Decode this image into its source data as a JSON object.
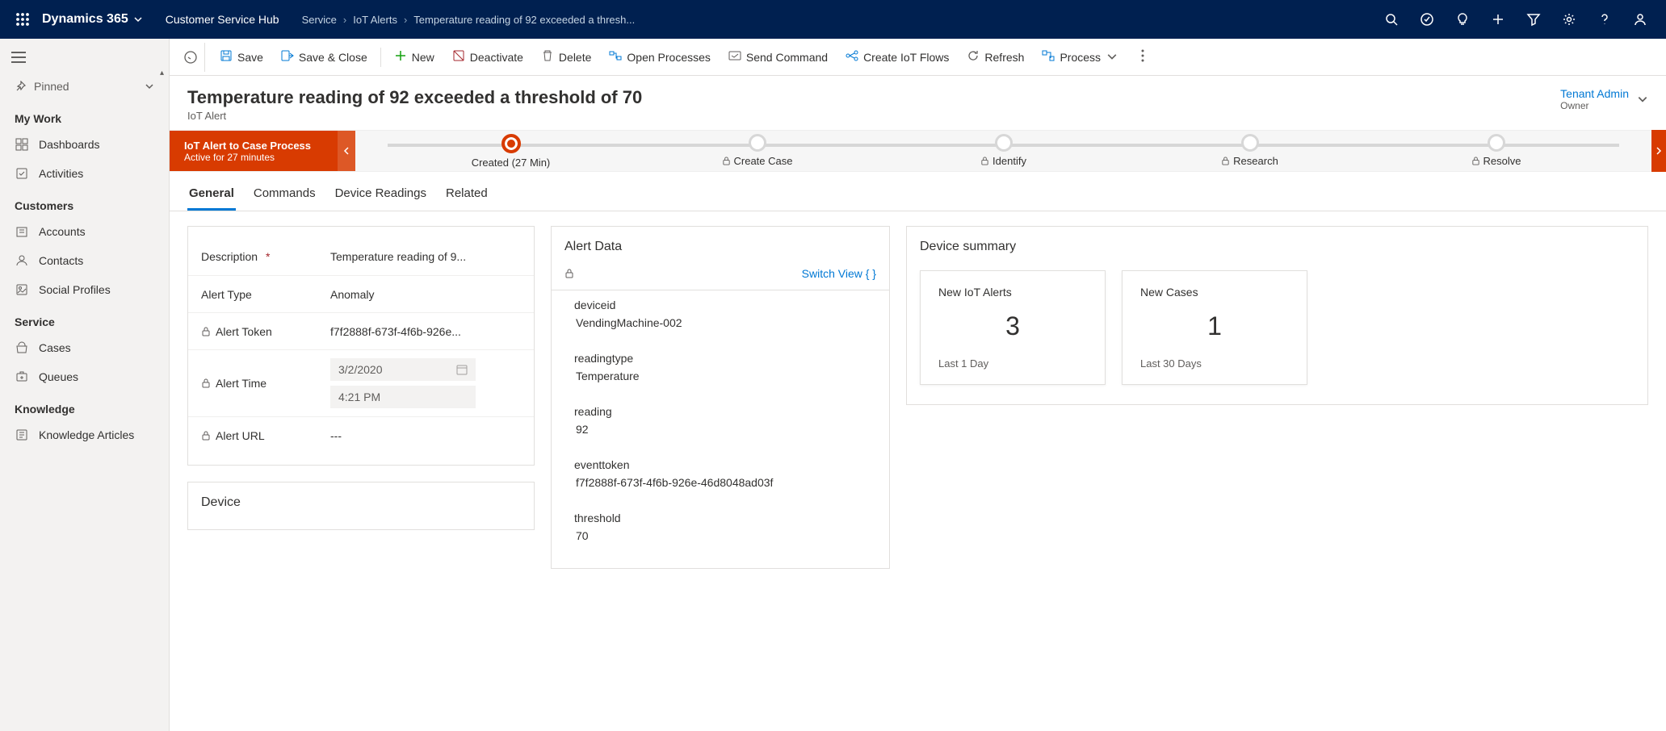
{
  "header": {
    "brand": "Dynamics 365",
    "hub": "Customer Service Hub",
    "breadcrumb": [
      "Service",
      "IoT Alerts",
      "Temperature reading of 92 exceeded a thresh..."
    ]
  },
  "commands": [
    {
      "icon": "save",
      "label": "Save"
    },
    {
      "icon": "save-close",
      "label": "Save & Close"
    },
    {
      "icon": "plus",
      "label": "New"
    },
    {
      "icon": "deactivate",
      "label": "Deactivate"
    },
    {
      "icon": "delete",
      "label": "Delete"
    },
    {
      "icon": "processes",
      "label": "Open Processes"
    },
    {
      "icon": "send",
      "label": "Send Command"
    },
    {
      "icon": "flow",
      "label": "Create IoT Flows"
    },
    {
      "icon": "refresh",
      "label": "Refresh"
    },
    {
      "icon": "process",
      "label": "Process"
    }
  ],
  "sidebar": {
    "pinned": "Pinned",
    "groups": [
      {
        "title": "My Work",
        "items": [
          {
            "icon": "dashboard",
            "label": "Dashboards"
          },
          {
            "icon": "activity",
            "label": "Activities"
          }
        ]
      },
      {
        "title": "Customers",
        "items": [
          {
            "icon": "accounts",
            "label": "Accounts"
          },
          {
            "icon": "contacts",
            "label": "Contacts"
          },
          {
            "icon": "social",
            "label": "Social Profiles"
          }
        ]
      },
      {
        "title": "Service",
        "items": [
          {
            "icon": "cases",
            "label": "Cases"
          },
          {
            "icon": "queues",
            "label": "Queues"
          }
        ]
      },
      {
        "title": "Knowledge",
        "items": [
          {
            "icon": "knowledge",
            "label": "Knowledge Articles"
          }
        ]
      }
    ]
  },
  "record": {
    "title": "Temperature reading of 92 exceeded a threshold of 70",
    "entity": "IoT Alert",
    "owner_label": "Owner",
    "owner_value": "Tenant Admin"
  },
  "process": {
    "name": "IoT Alert to Case Process",
    "status": "Active for 27 minutes",
    "stages": [
      {
        "label": "Created  (27 Min)",
        "locked": false,
        "active": true
      },
      {
        "label": "Create Case",
        "locked": true
      },
      {
        "label": "Identify",
        "locked": true
      },
      {
        "label": "Research",
        "locked": true
      },
      {
        "label": "Resolve",
        "locked": true
      }
    ]
  },
  "tabs": [
    "General",
    "Commands",
    "Device Readings",
    "Related"
  ],
  "general_fields": {
    "description": {
      "label": "Description",
      "required": true,
      "value": "Temperature reading of 9..."
    },
    "alert_type": {
      "label": "Alert Type",
      "value": "Anomaly"
    },
    "alert_token": {
      "label": "Alert Token",
      "locked": true,
      "value": "f7f2888f-673f-4f6b-926e..."
    },
    "alert_time": {
      "label": "Alert Time",
      "locked": true,
      "date": "3/2/2020",
      "time": "4:21 PM"
    },
    "alert_url": {
      "label": "Alert URL",
      "locked": true,
      "value": "---"
    }
  },
  "device_section": {
    "title": "Device"
  },
  "alert_data": {
    "title": "Alert Data",
    "switch": "Switch View  { }",
    "items": [
      {
        "k": "deviceid",
        "v": "VendingMachine-002"
      },
      {
        "k": "readingtype",
        "v": "Temperature"
      },
      {
        "k": "reading",
        "v": "92"
      },
      {
        "k": "eventtoken",
        "v": "f7f2888f-673f-4f6b-926e-46d8048ad03f"
      },
      {
        "k": "threshold",
        "v": "70"
      }
    ]
  },
  "device_summary": {
    "title": "Device summary",
    "cards": [
      {
        "title": "New IoT Alerts",
        "value": "3",
        "sub": "Last 1 Day"
      },
      {
        "title": "New Cases",
        "value": "1",
        "sub": "Last 30 Days"
      }
    ]
  }
}
